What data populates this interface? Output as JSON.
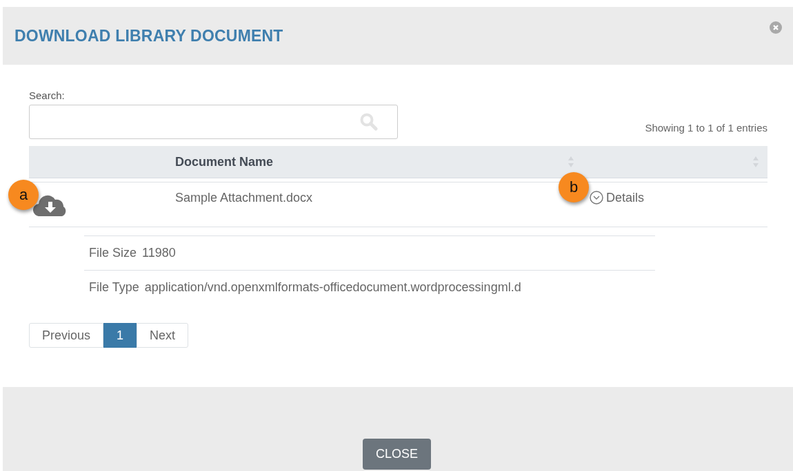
{
  "dialog": {
    "title": "DOWNLOAD LIBRARY DOCUMENT"
  },
  "search": {
    "label": "Search:"
  },
  "info": "Showing 1 to 1 of 1 entries",
  "table": {
    "columns": [
      {
        "sortable": false
      },
      {
        "label": "Document Name",
        "sortable": true
      },
      {
        "sortable": true
      }
    ],
    "rows": [
      {
        "name": "Sample Attachment.docx",
        "details_label": "Details",
        "expanded": true,
        "details": [
          {
            "label": "File Size",
            "value": "11980"
          },
          {
            "label": "File Type",
            "value": "application/vnd.openxmlformats-officedocument.wordprocessingml.d"
          }
        ]
      }
    ]
  },
  "pagination": {
    "previous": "Previous",
    "next": "Next",
    "pages": [
      {
        "label": "1",
        "selected": true
      }
    ]
  },
  "annotations": [
    {
      "label": "a"
    },
    {
      "label": "b"
    }
  ],
  "buttons": [
    {
      "label": "CLOSE"
    }
  ]
}
